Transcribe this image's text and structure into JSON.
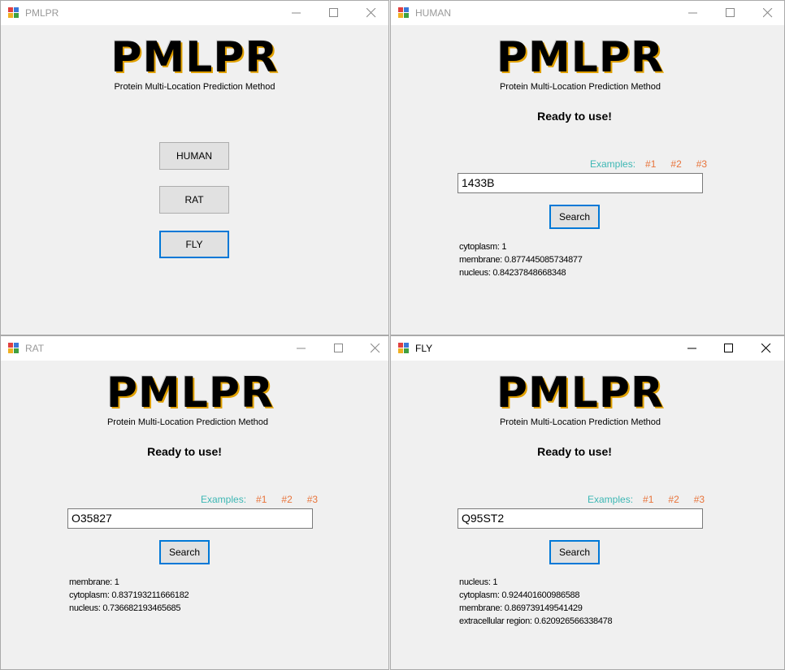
{
  "colors": {
    "accent": "#0078d7",
    "examples_label": "#3db7b4",
    "example_link": "#e8743b"
  },
  "icons": {
    "app": "winforms-app-icon",
    "minimize": "minimize-icon",
    "maximize": "maximize-icon",
    "close": "close-icon"
  },
  "main_window": {
    "title": "PMLPR",
    "logo": "PMLPR",
    "subtitle": "Protein Multi-Location Prediction Method",
    "buttons": [
      {
        "label": "HUMAN"
      },
      {
        "label": "RAT"
      },
      {
        "label": "FLY"
      }
    ]
  },
  "human_window": {
    "title": "HUMAN",
    "logo": "PMLPR",
    "subtitle": "Protein Multi-Location Prediction Method",
    "status": "Ready to use!",
    "examples_label": "Examples:",
    "examples": [
      "#1",
      "#2",
      "#3"
    ],
    "search_value": "1433B",
    "search_button": "Search",
    "results": [
      "cytoplasm: 1",
      "membrane: 0.877445085734877",
      "nucleus: 0.84237848668348"
    ]
  },
  "rat_window": {
    "title": "RAT",
    "logo": "PMLPR",
    "subtitle": "Protein Multi-Location Prediction Method",
    "status": "Ready to use!",
    "examples_label": "Examples:",
    "examples": [
      "#1",
      "#2",
      "#3"
    ],
    "search_value": "O35827",
    "search_button": "Search",
    "results": [
      "membrane: 1",
      "cytoplasm: 0.837193211666182",
      "nucleus: 0.736682193465685"
    ]
  },
  "fly_window": {
    "title": "FLY",
    "logo": "PMLPR",
    "subtitle": "Protein Multi-Location Prediction Method",
    "status": "Ready to use!",
    "examples_label": "Examples:",
    "examples": [
      "#1",
      "#2",
      "#3"
    ],
    "search_value": "Q95ST2",
    "search_button": "Search",
    "results": [
      "nucleus: 1",
      "cytoplasm: 0.924401600986588",
      "membrane: 0.869739149541429",
      "extracellular region: 0.620926566338478"
    ]
  }
}
